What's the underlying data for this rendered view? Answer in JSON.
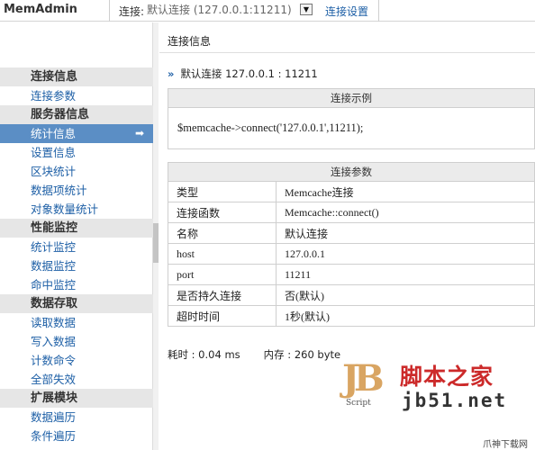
{
  "app": {
    "name": "MemAdmin"
  },
  "header": {
    "connection_label": "连接:",
    "connection_value": "默认连接 (127.0.0.1:11211)",
    "dropdown_glyph": "▼",
    "settings_link": "连接设置"
  },
  "sidebar": {
    "groups": [
      {
        "label": "连接信息",
        "items": [
          "连接参数"
        ]
      },
      {
        "label": "服务器信息",
        "items": [
          "统计信息",
          "设置信息",
          "区块统计",
          "数据项统计",
          "对象数量统计"
        ]
      },
      {
        "label": "性能监控",
        "items": [
          "统计监控",
          "数据监控",
          "命中监控"
        ]
      },
      {
        "label": "数据存取",
        "items": [
          "读取数据",
          "写入数据",
          "计数命令",
          "全部失效"
        ]
      },
      {
        "label": "扩展模块",
        "items": [
          "数据遍历",
          "条件遍历"
        ]
      }
    ],
    "active_item": "统计信息",
    "active_arrow": "➡"
  },
  "main": {
    "title": "连接信息",
    "current_connection": "默认连接 127.0.0.1 : 11211",
    "example": {
      "header": "连接示例",
      "code": "$memcache->connect('127.0.0.1',11211);"
    },
    "params": {
      "header": "连接参数",
      "rows": [
        {
          "key": "类型",
          "value": "Memcache连接"
        },
        {
          "key": "连接函数",
          "value": "Memcache::connect()"
        },
        {
          "key": "名称",
          "value": "默认连接"
        },
        {
          "key": "host",
          "value": "127.0.0.1"
        },
        {
          "key": "port",
          "value": "11211"
        },
        {
          "key": "是否持久连接",
          "value": "否(默认)"
        },
        {
          "key": "超时时间",
          "value": "1秒(默认)"
        }
      ]
    },
    "stats": {
      "time": "耗时 : 0.04 ms",
      "memory": "内存 : 260 byte"
    }
  },
  "watermark": {
    "logo_letters": "JB",
    "script_text": "Script",
    "site_name": "脚本之家",
    "url": "jb51.net",
    "corner": "爪神下载网"
  }
}
